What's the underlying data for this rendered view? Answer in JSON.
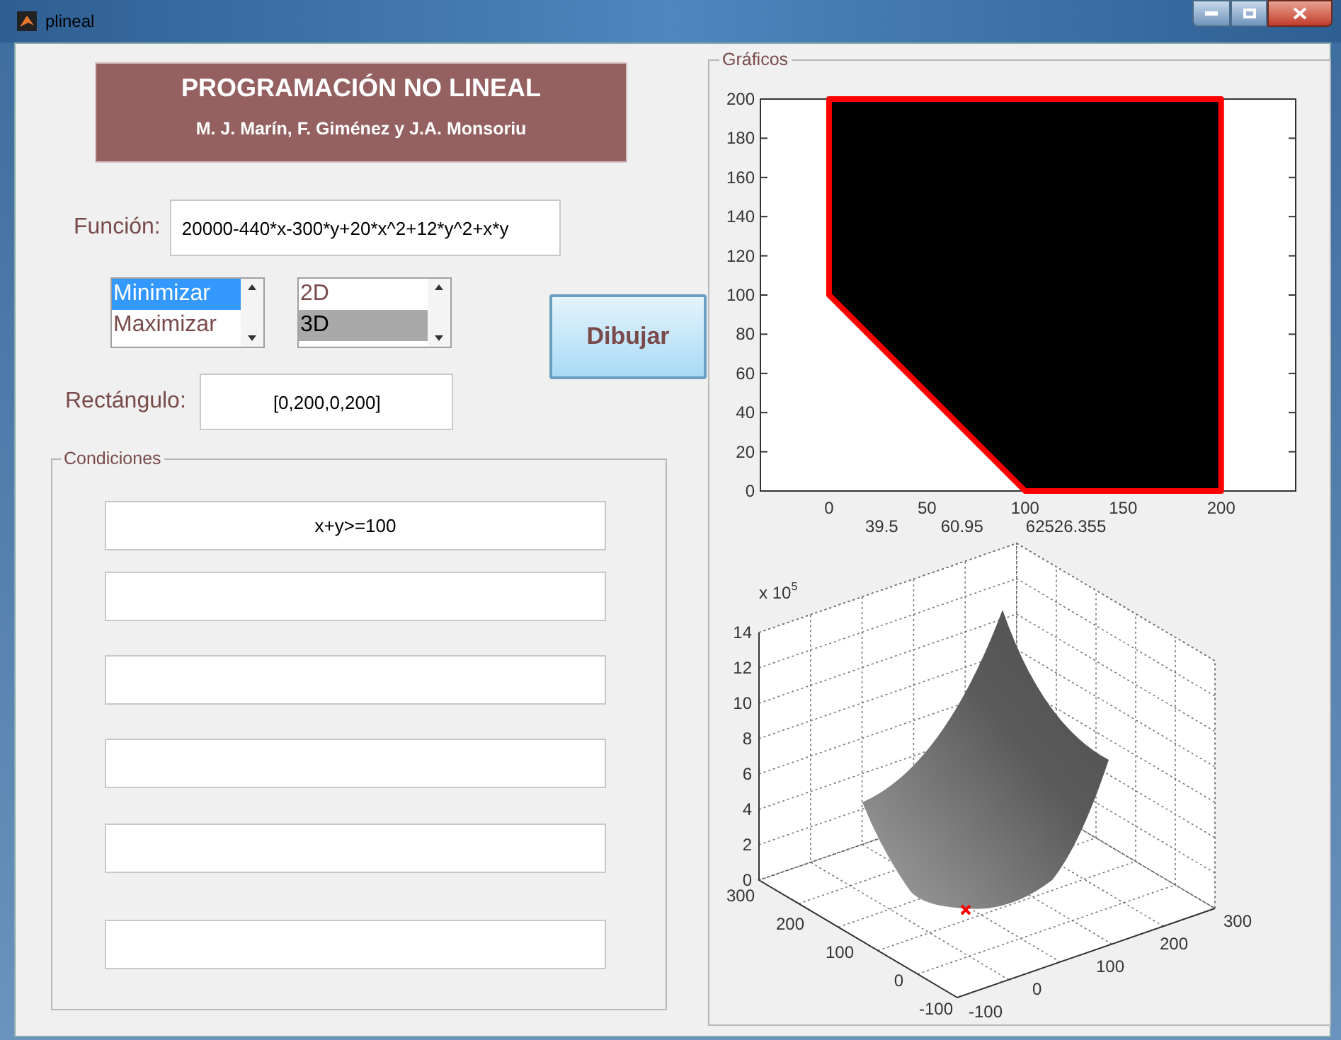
{
  "window": {
    "title": "plineal"
  },
  "header": {
    "title": "PROGRAMACIÓN NO LINEAL",
    "authors": "M. J. Marín, F. Giménez y J.A. Monsoriu"
  },
  "function_field": {
    "label": "Función:",
    "value": "20000-440*x-300*y+20*x^2+12*y^2+x*y"
  },
  "listboxes": [
    {
      "focused": true,
      "items": [
        {
          "label": "Minimizar",
          "selected": true
        },
        {
          "label": "Maximizar",
          "selected": false
        }
      ]
    },
    {
      "focused": false,
      "items": [
        {
          "label": "2D",
          "selected": false
        },
        {
          "label": "3D",
          "selected": true
        }
      ]
    }
  ],
  "draw_button": "Dibujar",
  "rectangle_field": {
    "label": "Rectángulo:",
    "value": "[0,200,0,200]"
  },
  "conditions": {
    "title": "Condiciones",
    "fields": [
      {
        "kind": "text",
        "value": "x+y>=100"
      },
      {
        "kind": "text"
      },
      {
        "kind": "text"
      },
      {
        "kind": "text"
      },
      {
        "kind": "text"
      },
      {
        "kind": "text"
      }
    ]
  },
  "graphics": {
    "title": "Gráficos",
    "chart_data": {
      "type": "area",
      "x": [
        0,
        0,
        200,
        200,
        100,
        0
      ],
      "series": [
        {
          "color": "#ff0000",
          "values": [
            100,
            200,
            200,
            0,
            0,
            100
          ]
        }
      ],
      "xlim": [
        -35,
        238
      ],
      "ylim": [
        0,
        200
      ],
      "xticks": [
        0,
        50,
        100,
        150,
        200
      ],
      "yticks": [
        0,
        20,
        40,
        60,
        80,
        100,
        120,
        140,
        160,
        180,
        200
      ]
    },
    "readouts": [
      "39.5",
      "60.95",
      "62526.355"
    ],
    "plot_3d": {
      "z_scale": "x 10",
      "z_exponent": "5",
      "z_ticks": [
        "14",
        "12",
        "10",
        "8",
        "6",
        "4",
        "2",
        "0"
      ],
      "y_ticks": [
        "300",
        "200",
        "100",
        "0",
        "-100"
      ],
      "x_ticks": [
        "-100",
        "0",
        "100",
        "200",
        "300"
      ]
    }
  }
}
